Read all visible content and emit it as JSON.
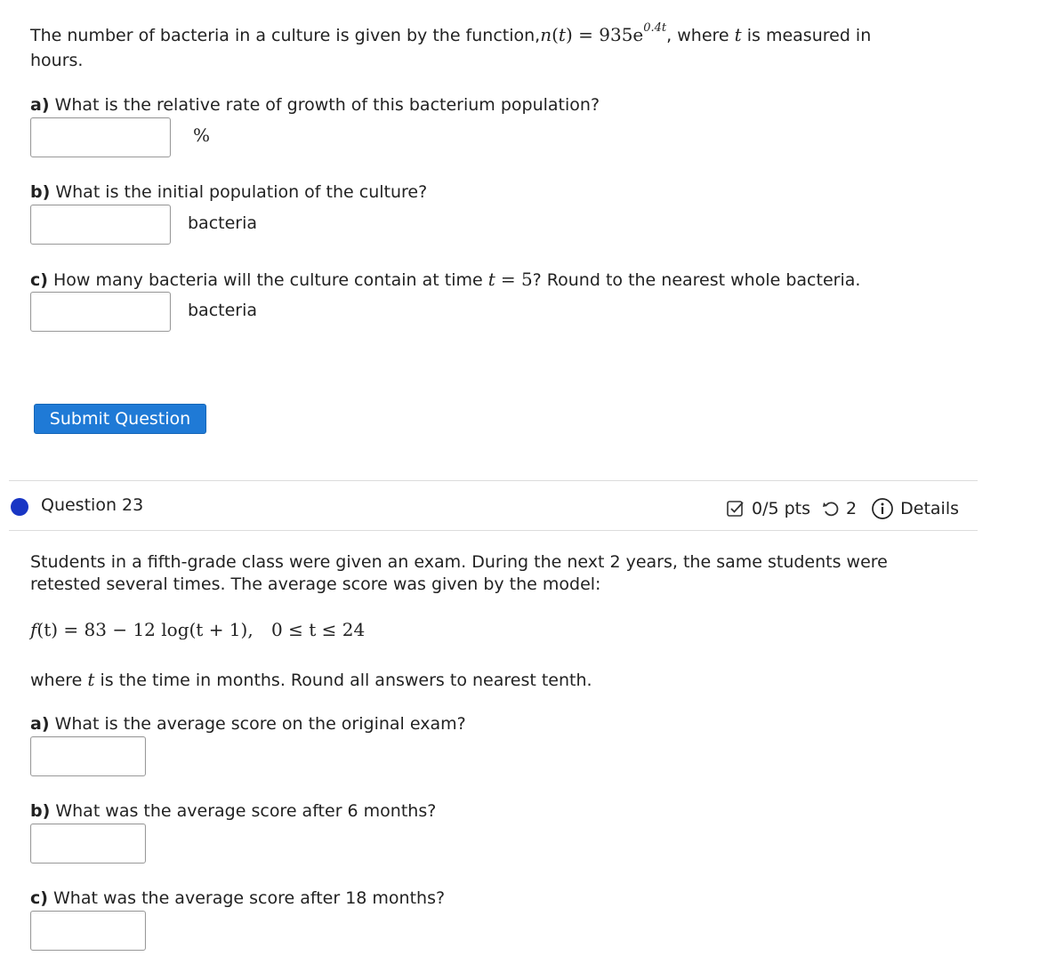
{
  "q22": {
    "intro_a": "The number of bacteria in a culture is given by the function,",
    "func_name": "n",
    "func_var": "t",
    "func_rhs": "= 935e",
    "func_exp": "0.4t",
    "intro_b": ", where",
    "var_t": "t",
    "intro_c": "is measured in",
    "intro_d": "hours.",
    "a_label": "a)",
    "a_text": "What is the relative rate of growth of this bacterium population?",
    "a_unit": "%",
    "b_label": "b)",
    "b_text": "What is the initial population of the culture?",
    "b_unit": "bacteria",
    "c_label": "c)",
    "c_text_1": "How many bacteria will the culture contain at time",
    "c_var": "t",
    "c_eq": "= 5",
    "c_text_2": "? Round to the nearest whole bacteria.",
    "c_unit": "bacteria",
    "submit_label": "Submit Question"
  },
  "q23": {
    "title": "Question 23",
    "points": "0/5 pts",
    "retries": "2",
    "details": "Details",
    "body_1": "Students in a fifth-grade class were given an exam. During the next 2 years, the same students were",
    "body_2": "retested several times. The average score was given by the model:",
    "formula_f": "f",
    "formula_lhs_rest": "(t) = 83 − 12 log(t + 1),",
    "formula_domain": "0 ≤ t ≤ 24",
    "where_1": "where",
    "where_t": "t",
    "where_2": "is the time in months. Round all answers to nearest tenth.",
    "a_label": "a)",
    "a_text": "What is the average score on the original exam?",
    "b_label": "b)",
    "b_text": "What was the average score after 6 months?",
    "c_label": "c)",
    "c_text": "What was the average score after 18 months?"
  }
}
